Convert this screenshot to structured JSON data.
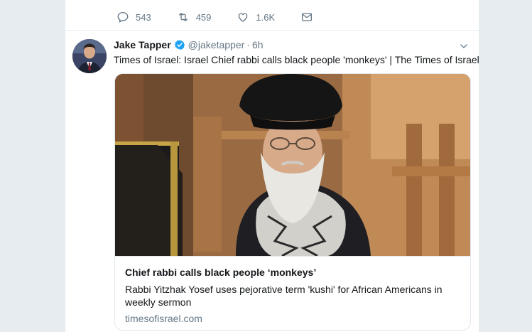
{
  "prev_tweet_actions": {
    "replies": "543",
    "retweets": "459",
    "likes": "1.6K"
  },
  "tweet": {
    "author_name": "Jake Tapper",
    "handle": "@jaketapper",
    "separator": "·",
    "time": "6h",
    "text": "Times of Israel: Israel Chief rabbi calls black people 'monkeys' | The Times of Israel",
    "verified": true
  },
  "card": {
    "title": "Chief rabbi calls black people ‘monkeys’",
    "description": "Rabbi Yitzhak Yosef uses pejorative term 'kushi' for African Americans in weekly sermon",
    "domain": "timesofisrael.com"
  },
  "icons": {
    "reply": "reply-icon",
    "retweet": "retweet-icon",
    "like": "heart-icon",
    "dm": "envelope-icon",
    "verified": "verified-badge-icon",
    "caret": "chevron-down-icon"
  },
  "colors": {
    "background": "#e6ecf0",
    "text": "#14171a",
    "muted": "#657786",
    "verified": "#1da1f2"
  }
}
